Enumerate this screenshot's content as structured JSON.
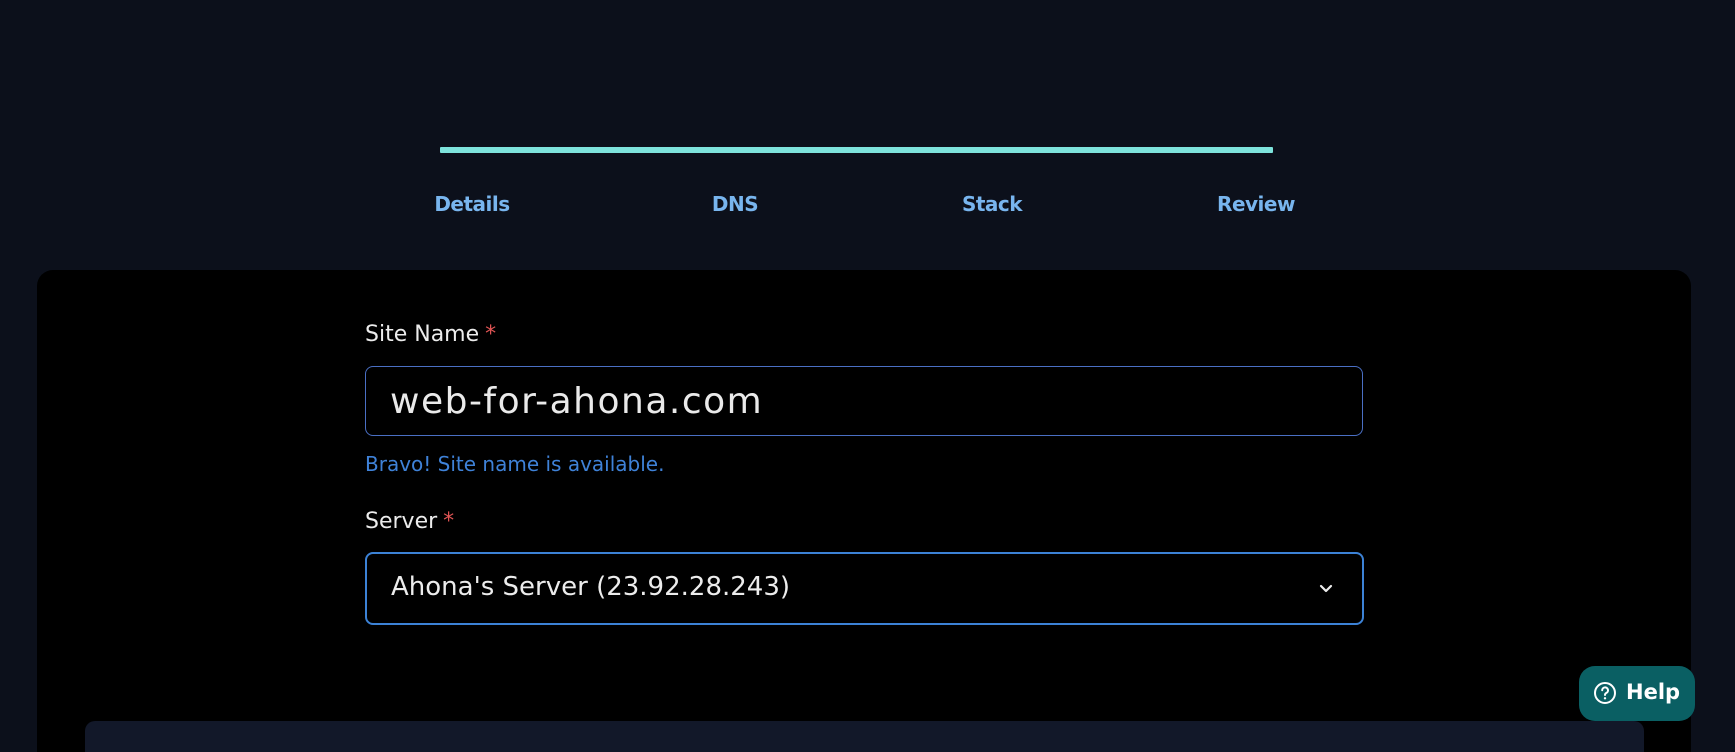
{
  "progress": {
    "fill": 1.0,
    "color": "#7ee3dc"
  },
  "steps": [
    {
      "label": "Details"
    },
    {
      "label": "DNS"
    },
    {
      "label": "Stack"
    },
    {
      "label": "Review"
    }
  ],
  "form": {
    "site_name": {
      "label": "Site Name",
      "required_mark": "*",
      "value": "web-for-ahona.com",
      "hint": "Bravo! Site name is available."
    },
    "server": {
      "label": "Server",
      "required_mark": "*",
      "selected": "Ahona's Server (23.92.28.243)"
    }
  },
  "help": {
    "label": "Help",
    "icon": "question-circle-icon"
  },
  "colors": {
    "accent": "#78b5ee",
    "hint": "#3f82d8",
    "required": "#e25555",
    "help_bg": "#0a5f63"
  }
}
